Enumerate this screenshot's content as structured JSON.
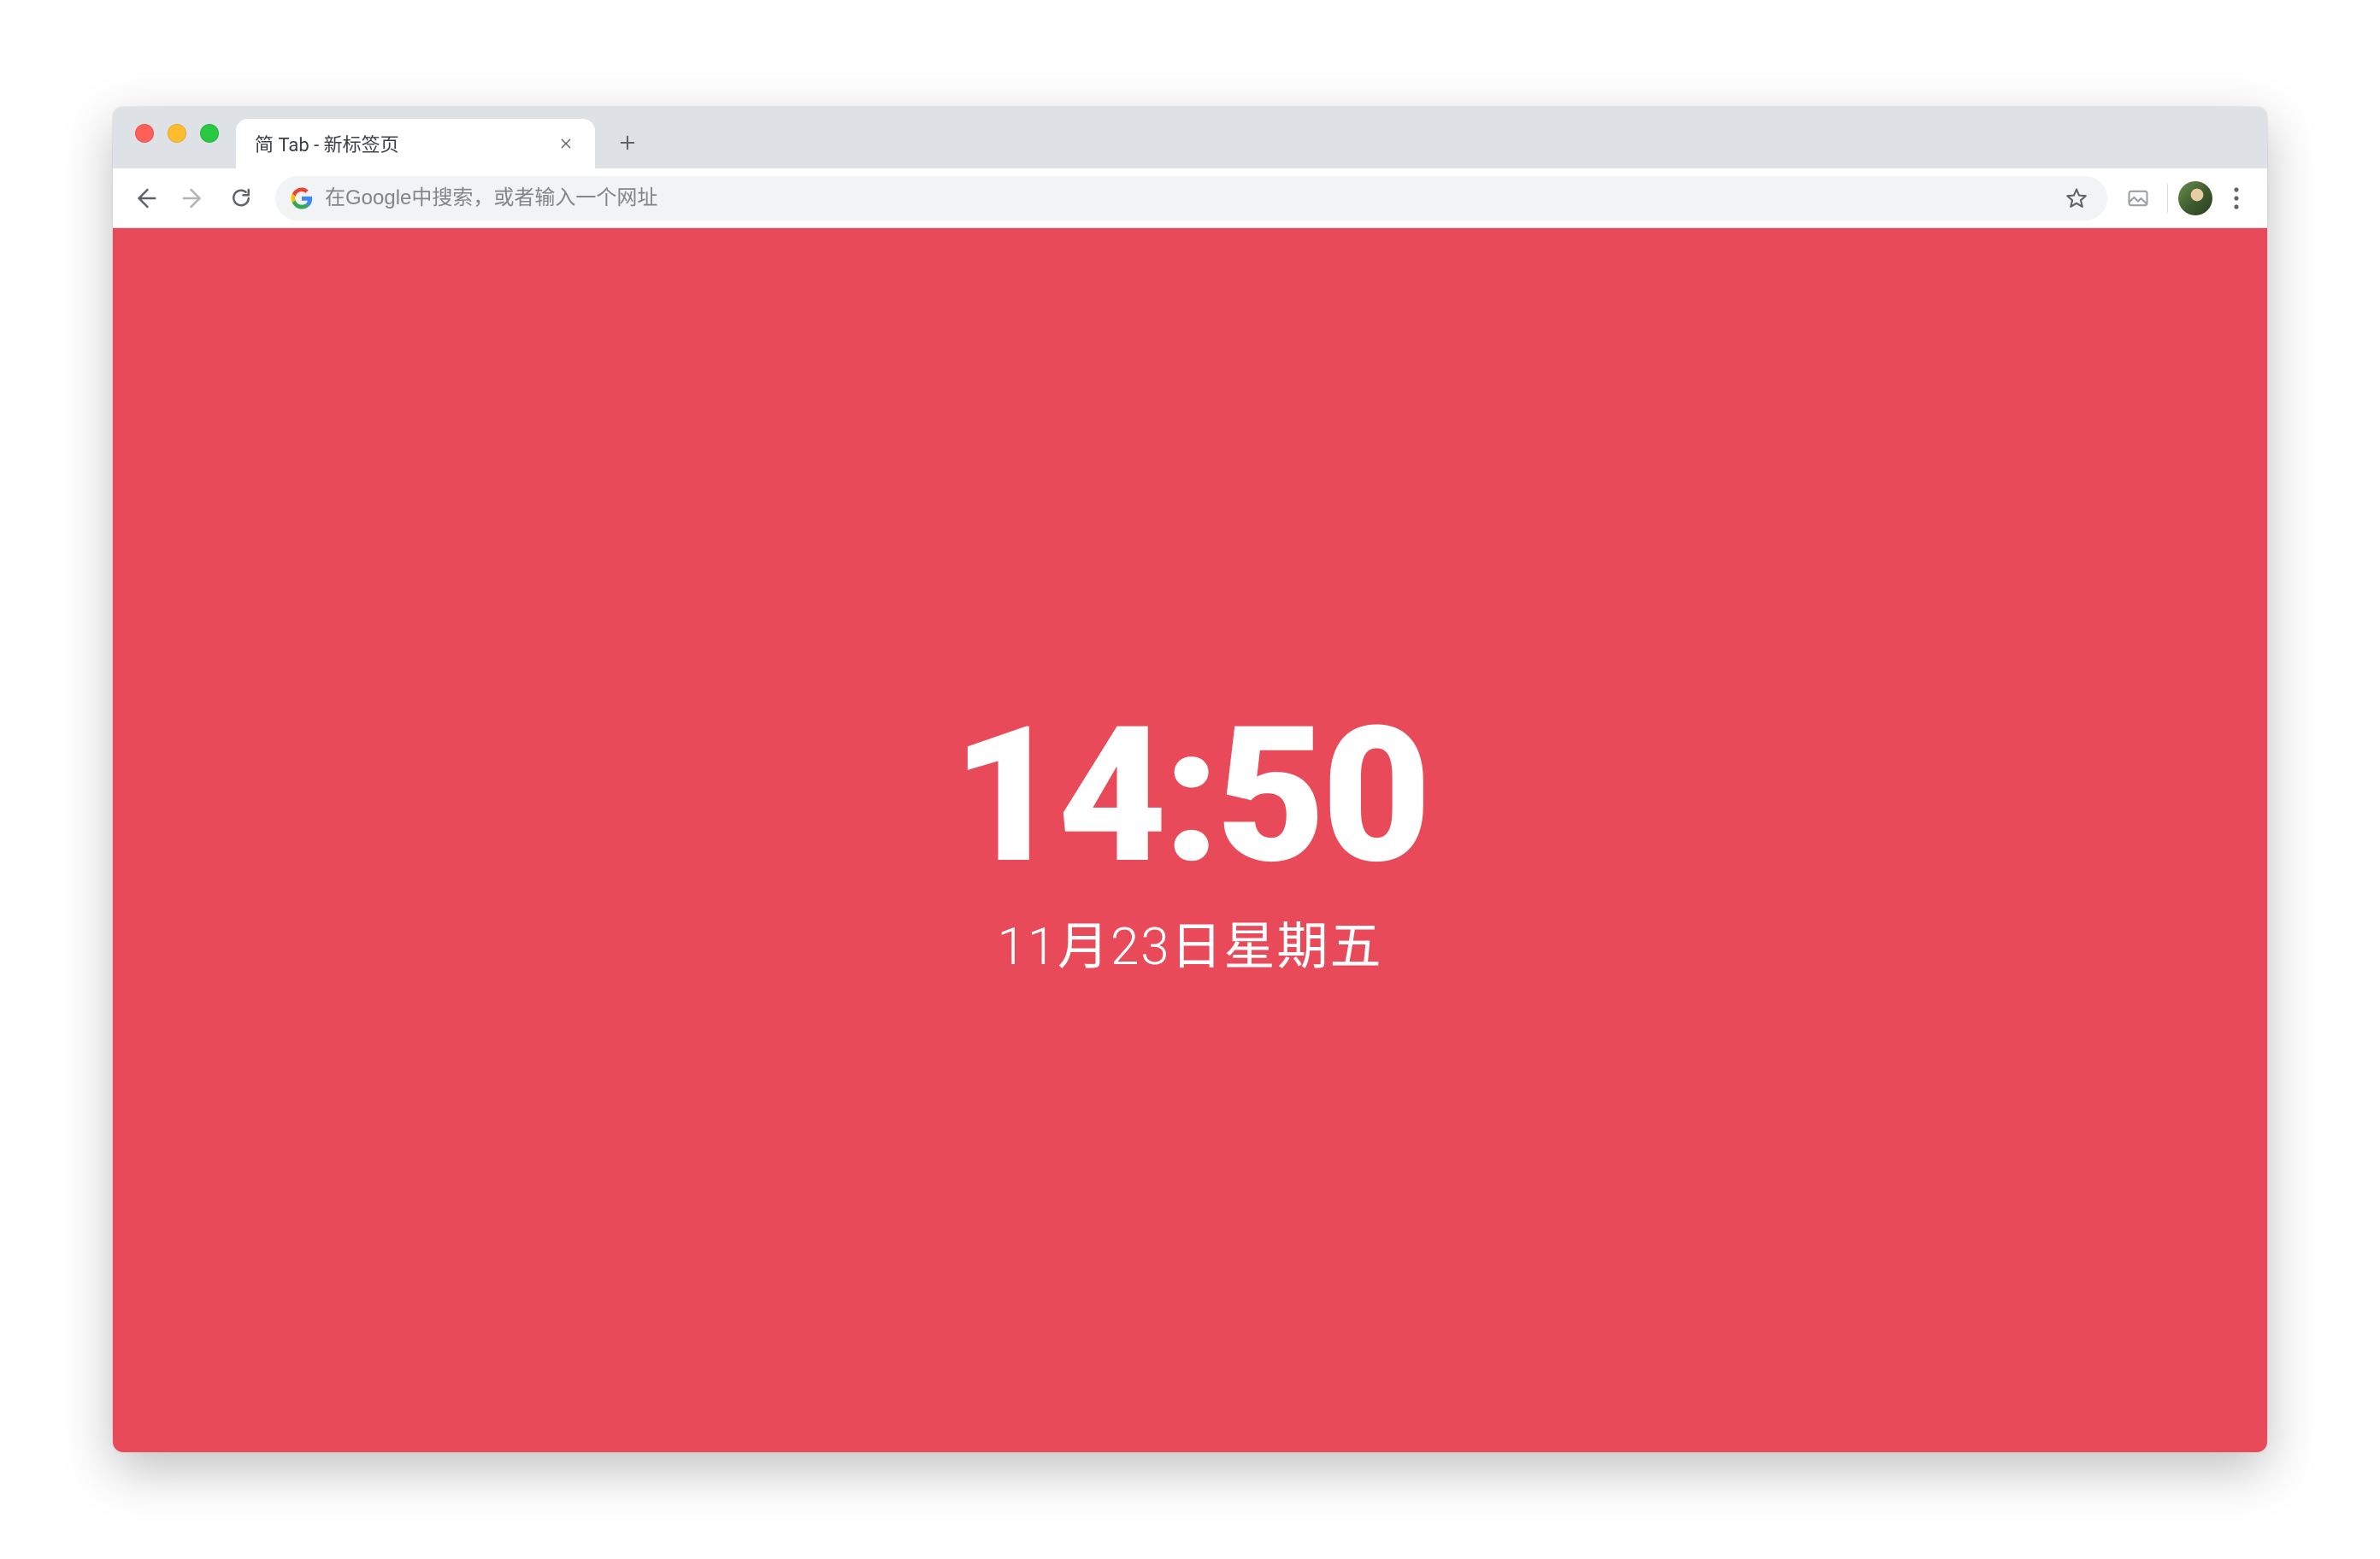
{
  "window": {
    "traffic_lights": {
      "close": "close",
      "minimize": "minimize",
      "zoom": "zoom"
    }
  },
  "tabs": {
    "active": {
      "title": "简 Tab - 新标签页"
    }
  },
  "toolbar": {
    "back": "back",
    "forward": "forward",
    "reload": "reload",
    "omnibox": {
      "placeholder": "在Google中搜索，或者输入一个网址",
      "value": ""
    },
    "bookmark": "bookmark-star",
    "extension": "extension",
    "profile": "profile-avatar",
    "menu": "kebab-menu"
  },
  "page": {
    "background": "#e94a5a",
    "clock": "14:50",
    "date": "11月23日星期五"
  }
}
